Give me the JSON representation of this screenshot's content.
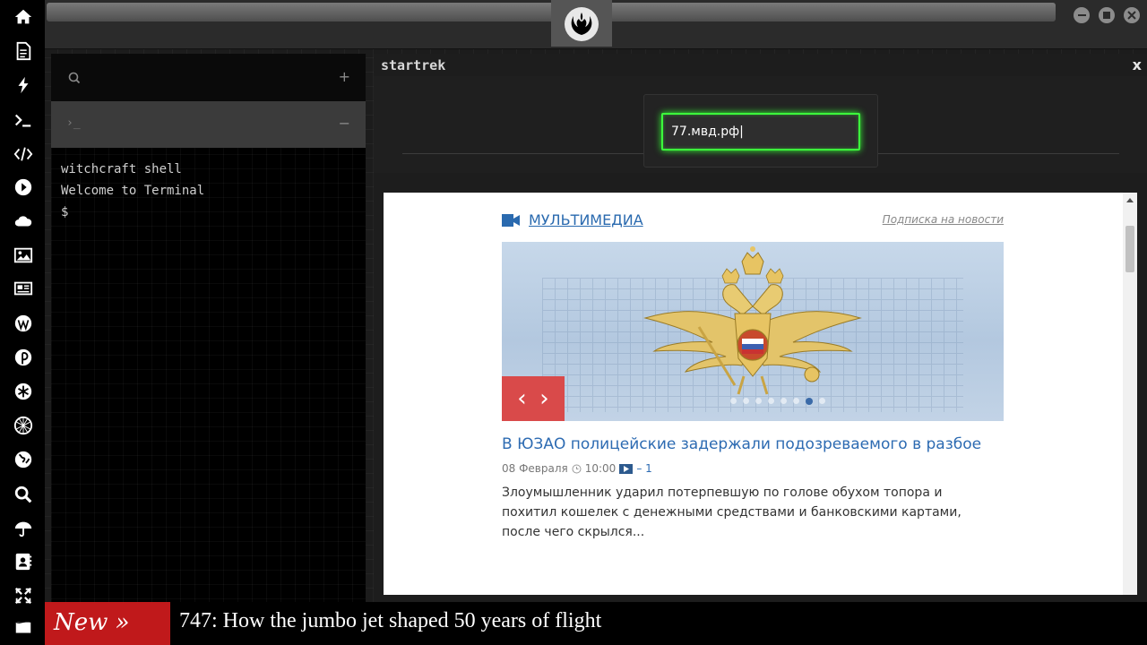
{
  "sidebar": {
    "icons": [
      "home-icon",
      "document-icon",
      "bolt-icon",
      "terminal-icon",
      "code-icon",
      "play-icon",
      "cloud-icon",
      "image-icon",
      "newspaper-icon",
      "wordpress-icon",
      "pinterest-icon",
      "asterisk-icon",
      "globe-net-icon",
      "globe-icon",
      "search-icon",
      "umbrella-icon",
      "contacts-icon",
      "expand-icon",
      "flag-icon"
    ]
  },
  "terminal": {
    "search_icon": "search-icon",
    "add_label": "+",
    "tab_prompt": "›_",
    "collapse_label": "−",
    "lines": [
      "witchcraft shell",
      "Welcome to Terminal",
      "$"
    ]
  },
  "browser": {
    "title": "startrek",
    "close_label": "x",
    "url_value": "77.мвд.рф"
  },
  "page": {
    "section_link": "МУЛЬТИМЕДИА",
    "subscribe_link": "Подписка на новости",
    "prev_label": "‹",
    "next_label": "›",
    "headline": "В ЮЗАО полицейские задержали подозреваемого в разбое",
    "date": "08 Февраля",
    "time": "10:00",
    "video_count": "– 1",
    "description": "Злоумышленник ударил потерпевшую по голове обухом топора и похитил кошелек с денежными средствами и банковскими картами, после чего скрылся..."
  },
  "ticker": {
    "label": "New »",
    "headline": "747: How the jumbo jet shaped 50 years of flight"
  },
  "colors": {
    "accent_green": "#3cff3c",
    "ticker_red": "#c0191b",
    "link_blue": "#2a6aaf",
    "slider_nav_red": "#d94a4a"
  }
}
